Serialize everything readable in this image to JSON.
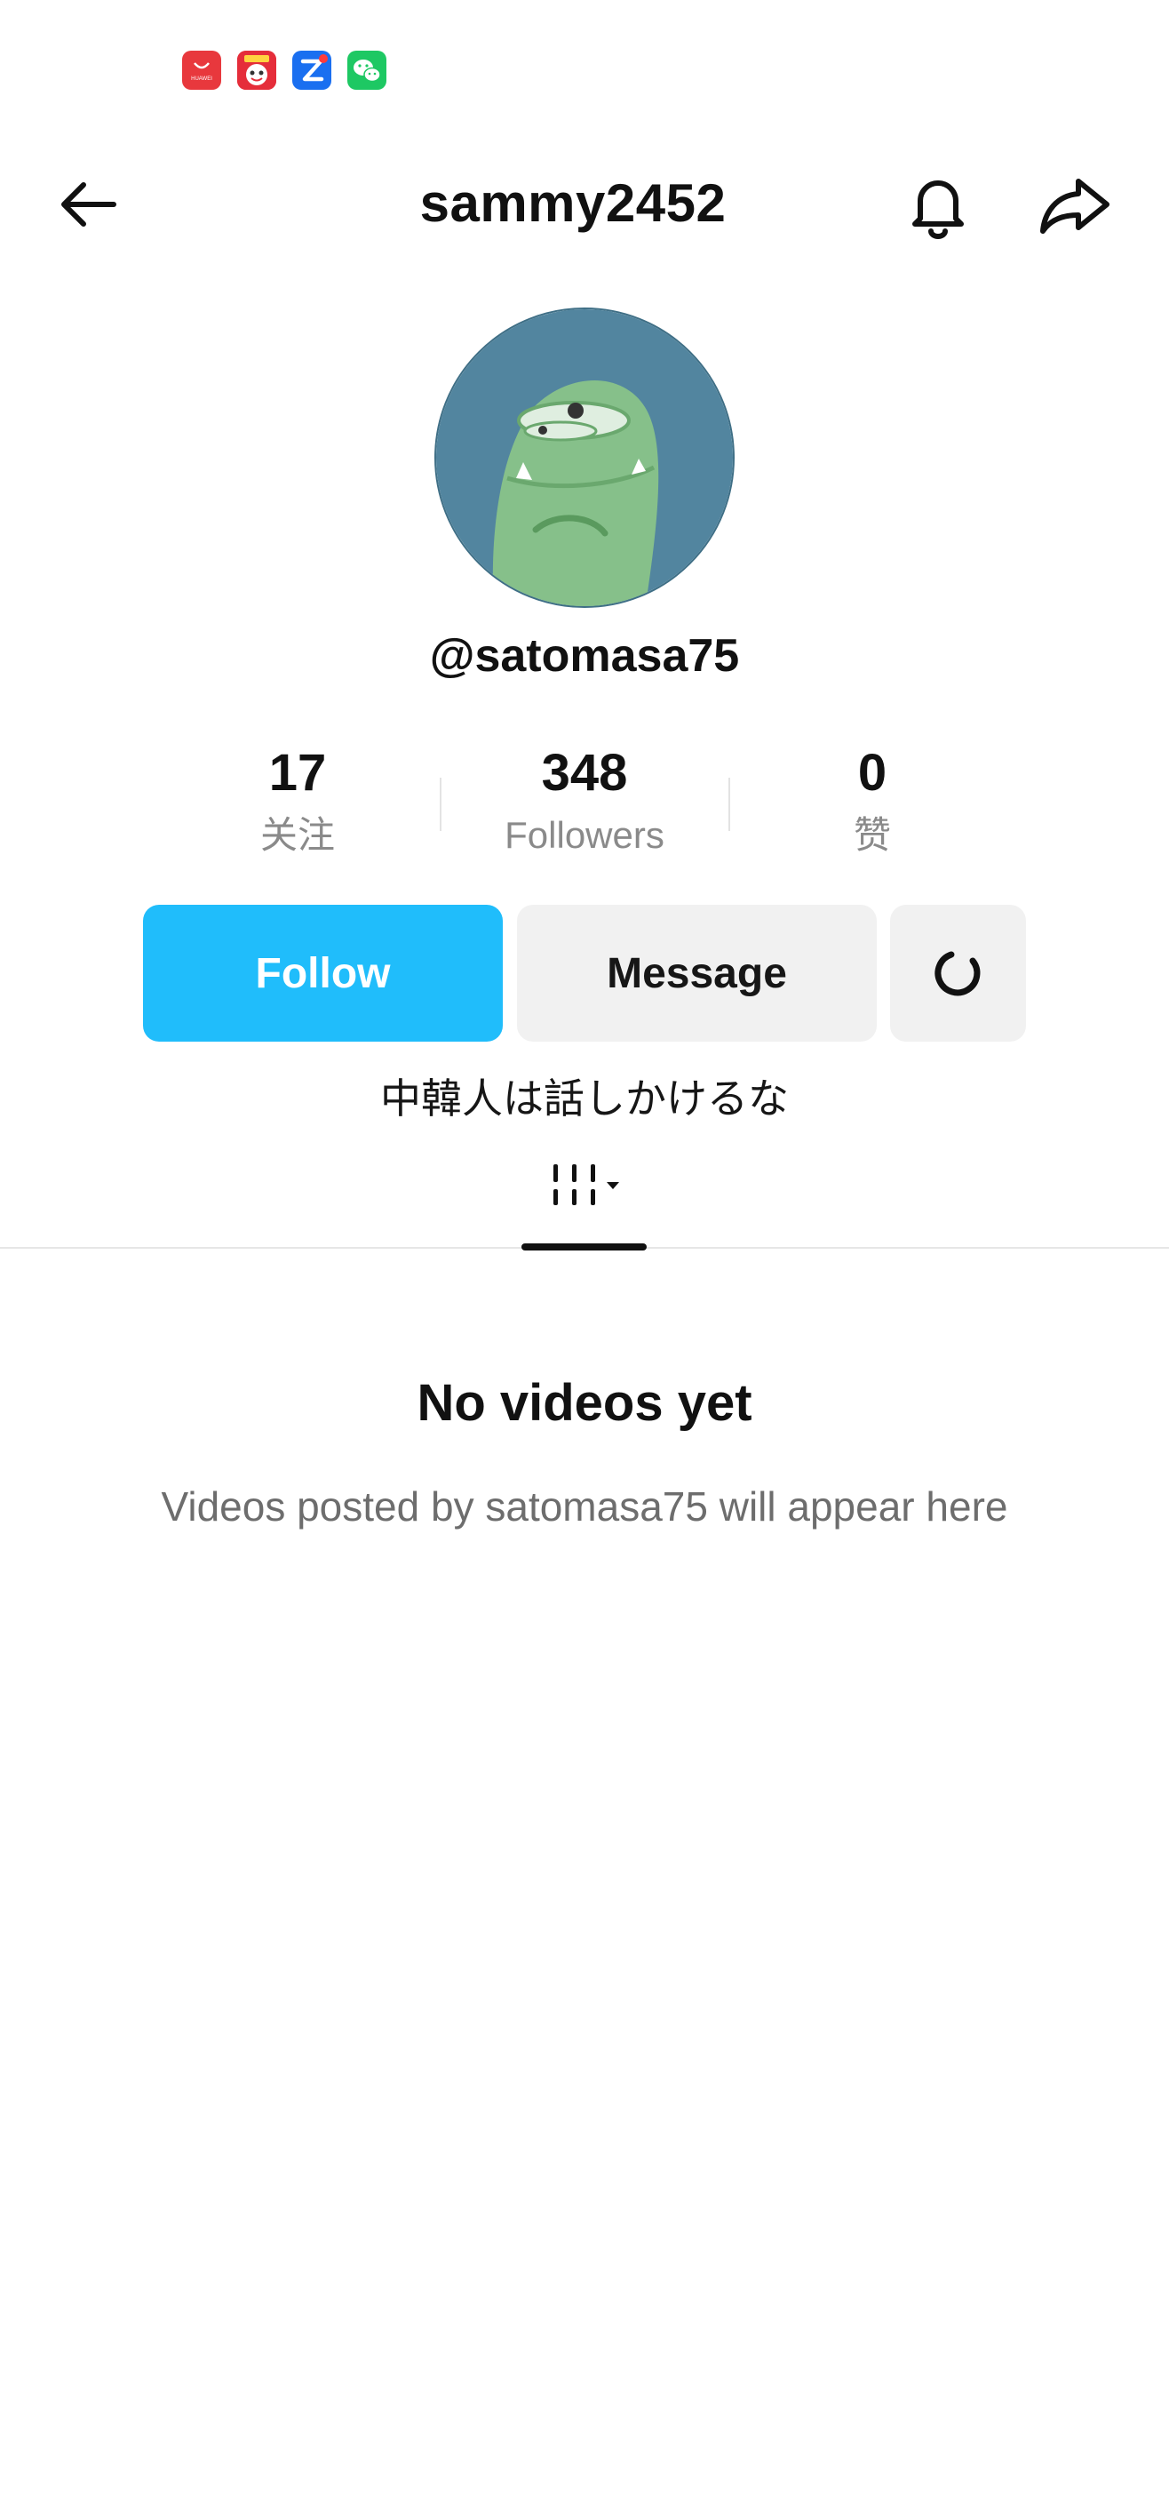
{
  "status_bar": {
    "app_icons": [
      {
        "name": "huawei-appgallery-icon",
        "text": "HUAWEI",
        "color": "#e8383d"
      },
      {
        "name": "shopping-app-icon",
        "text": "",
        "color": "#e52d3a"
      },
      {
        "name": "zhihu-icon",
        "text": "Z",
        "color": "#1a6ff0"
      },
      {
        "name": "wechat-icon",
        "text": "",
        "color": "#1ec863"
      }
    ]
  },
  "header": {
    "title": "sammy2452",
    "back_icon": "arrow-left-icon",
    "bell_icon": "bell-icon",
    "share_icon": "share-icon"
  },
  "profile": {
    "handle": "@satomasa75",
    "bio": "中韓人は話しかけるな",
    "stats": [
      {
        "value": "17",
        "label": "关注"
      },
      {
        "value": "348",
        "label": "Followers"
      },
      {
        "value": "0",
        "label": "赞"
      }
    ]
  },
  "actions": {
    "follow_label": "Follow",
    "message_label": "Message",
    "more_icon": "refresh-icon"
  },
  "tabs": {
    "active_icon": "video-grid-icon"
  },
  "empty_state": {
    "title": "No videos yet",
    "description": "Videos posted by satomasa75 will appear here"
  },
  "colors": {
    "accent": "#20bdfb",
    "secondary_button": "#f1f1f1",
    "muted_text": "#8a8a8a"
  }
}
